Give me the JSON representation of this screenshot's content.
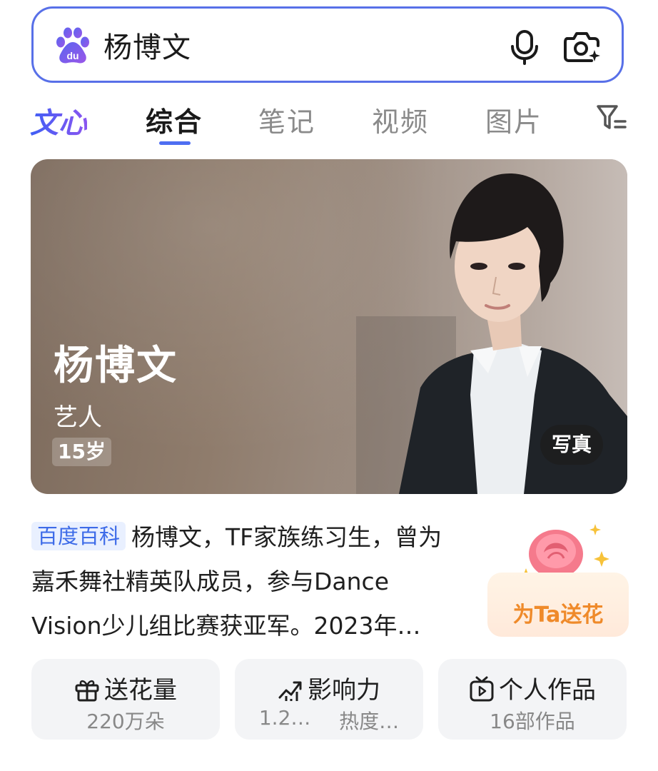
{
  "search": {
    "query": "杨博文"
  },
  "tabs": {
    "brand": "文心",
    "items": [
      {
        "label": "综合",
        "active": true
      },
      {
        "label": "笔记",
        "active": false
      },
      {
        "label": "视频",
        "active": false
      },
      {
        "label": "图片",
        "active": false
      }
    ]
  },
  "hero": {
    "name": "杨博文",
    "role": "艺人",
    "age": "15岁",
    "photo_label": "写真"
  },
  "baike": {
    "tag": "百度百科",
    "text": "杨博文，TF家族练习生，曾为嘉禾舞社精英队成员，参与Dance Vision少儿组比赛获亚军。2023年…"
  },
  "flower": {
    "label": "为Ta送花"
  },
  "stats": [
    {
      "title": "送花量",
      "icon": "gift-icon",
      "value": "220万朵"
    },
    {
      "title": "影响力",
      "icon": "trend-chart-icon",
      "value_left": "1.2…",
      "value_right": "热度…"
    },
    {
      "title": "个人作品",
      "icon": "video-play-icon",
      "value": "16部作品"
    }
  ],
  "colors": {
    "accent": "#4e6ef2",
    "flower": "#ef8a2a",
    "baike_tag": "#3d6be8"
  }
}
